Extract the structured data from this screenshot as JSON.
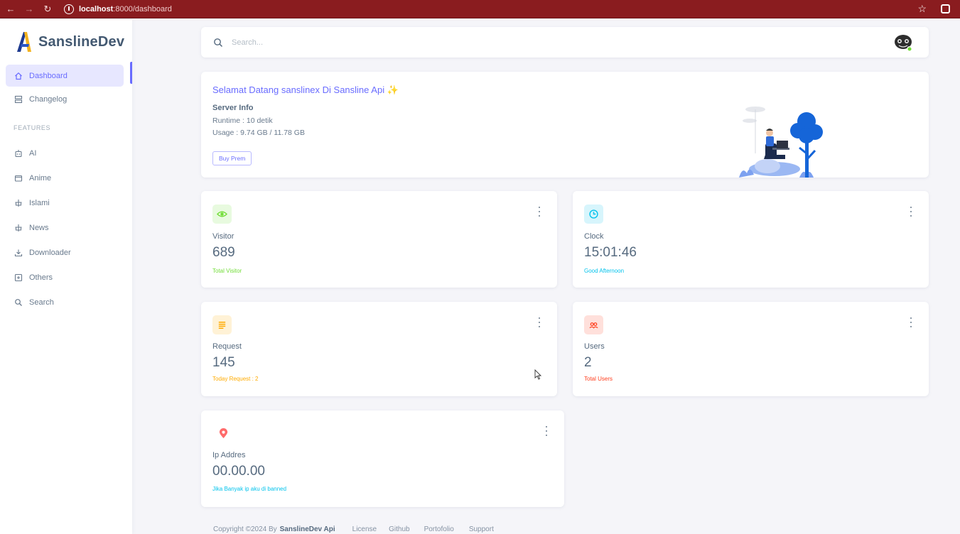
{
  "browser": {
    "url_host": "localhost",
    "url_path": ":8000/dashboard",
    "back_icon": "arrow-left",
    "forward_icon": "arrow-right",
    "reload_icon": "reload",
    "star_icon": "star",
    "extension_icon": "extension"
  },
  "sidebar": {
    "brand": "SanslineDev",
    "items": [
      {
        "label": "Dashboard",
        "icon": "home-icon",
        "active": true
      },
      {
        "label": "Changelog",
        "icon": "server-icon",
        "active": false
      }
    ],
    "section_header": "FEATURES",
    "features": [
      {
        "label": "AI",
        "icon": "robot-icon"
      },
      {
        "label": "Anime",
        "icon": "window-icon"
      },
      {
        "label": "Islami",
        "icon": "cross-icon"
      },
      {
        "label": "News",
        "icon": "cross-icon"
      },
      {
        "label": "Downloader",
        "icon": "download-icon"
      },
      {
        "label": "Others",
        "icon": "box-icon"
      },
      {
        "label": "Search",
        "icon": "search-icon"
      }
    ],
    "accent_color": "#696cff"
  },
  "search": {
    "placeholder": "Search..."
  },
  "welcome": {
    "title": "Selamat Datang sanslinex Di Sansline Api ✨",
    "server_info_title": "Server Info",
    "runtime": "Runtime : 10 detik",
    "usage": "Usage : 9.74 GB / 11.78 GB",
    "button_label": "Buy Prem"
  },
  "stats": [
    {
      "label": "Visitor",
      "value": "689",
      "sub": "Total Visitor",
      "icon": "eye-icon",
      "color": "#71dd37",
      "bg": "#e8fadf"
    },
    {
      "label": "Clock",
      "value": "15:01:46",
      "sub": "Good Afternoon",
      "icon": "clock-icon",
      "color": "#03c3ec",
      "bg": "#d7f5fc"
    },
    {
      "label": "Request",
      "value": "145",
      "sub": "Today Request : 2",
      "icon": "list-icon",
      "color": "#ffab00",
      "bg": "#fff2d6"
    },
    {
      "label": "Users",
      "value": "2",
      "sub": "Total Users",
      "icon": "users-icon",
      "color": "#ff3e1d",
      "bg": "#ffe0db"
    },
    {
      "label": "Ip Addres",
      "value": "00.00.00",
      "sub": "Jika Banyak ip aku di banned",
      "icon": "map-pin-icon",
      "color": "#03c3ec",
      "bg": "#ffffff"
    }
  ],
  "footer": {
    "copyright": "Copyright ©2024 By",
    "owner": "SanslineDev Api",
    "links": [
      "License",
      "Github",
      "Portofolio",
      "Support"
    ]
  }
}
